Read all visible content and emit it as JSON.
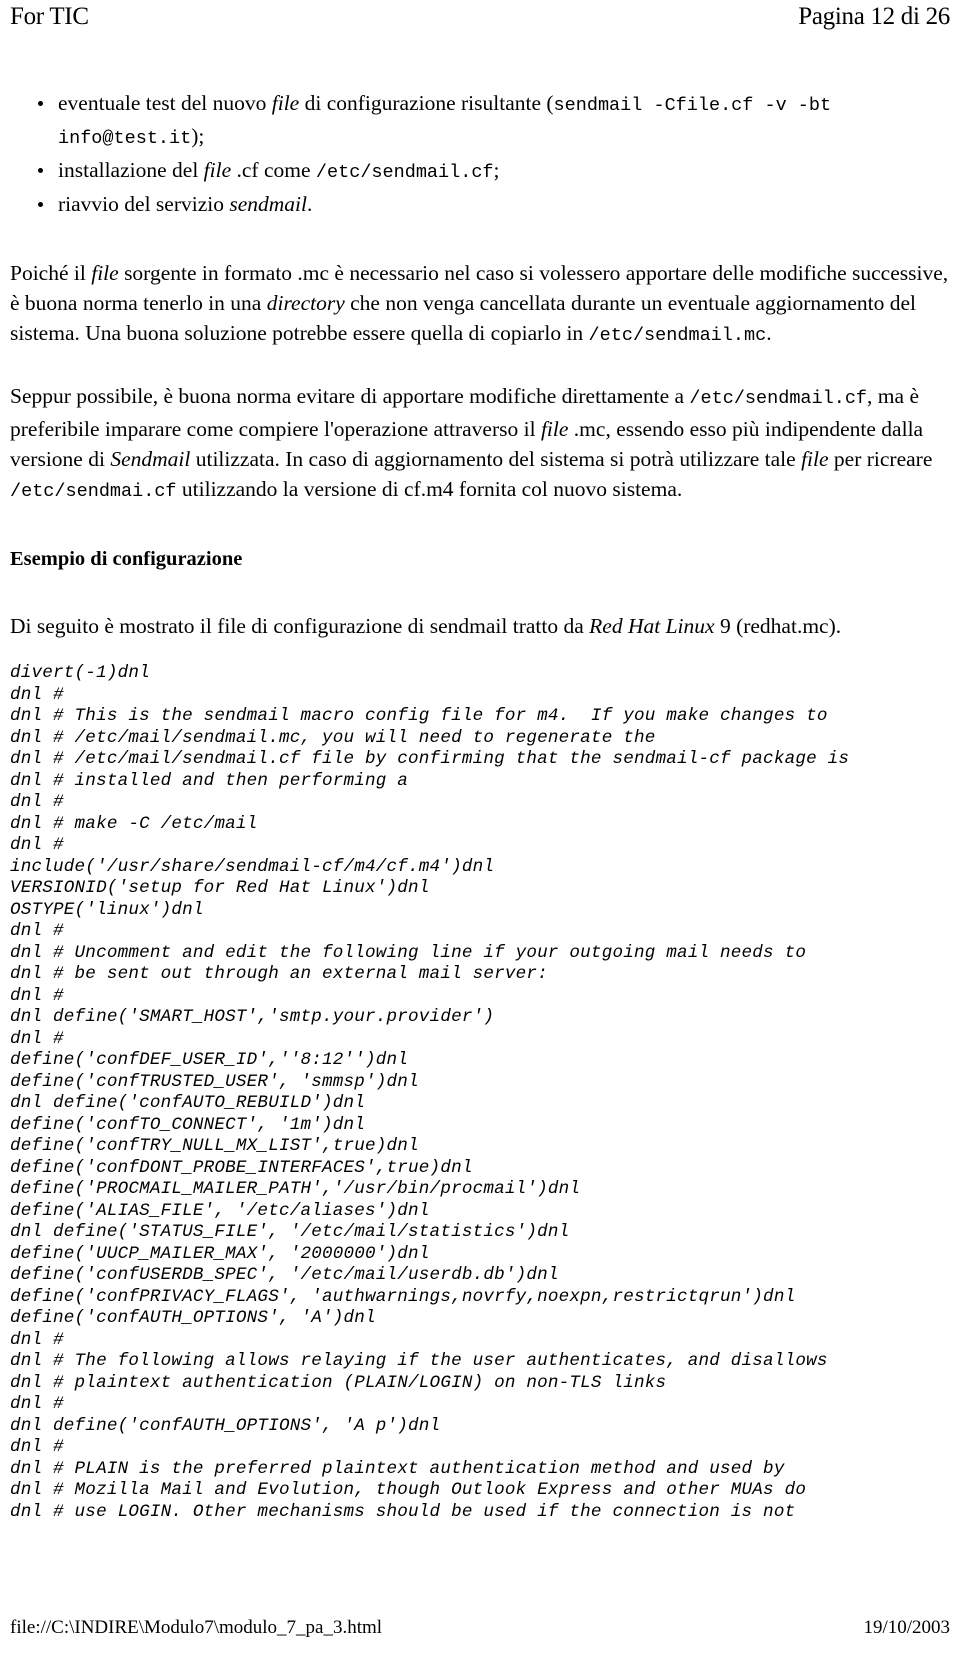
{
  "header": {
    "left": "For TIC",
    "right": "Pagina 12 di 26"
  },
  "bullets": [
    {
      "pre": "eventuale test del nuovo ",
      "italic": "file",
      "mid": " di configurazione risultante (",
      "code": "sendmail -Cfile.cf -v -bt info@test.it",
      "post": ");"
    },
    {
      "pre": "installazione del ",
      "italic": "file",
      "mid": " .cf come ",
      "code": "/etc/sendmail.cf",
      "post": ";"
    },
    {
      "pre": "riavvio del servizio ",
      "italic": "sendmail",
      "mid": "",
      "code": "",
      "post": "."
    }
  ],
  "paragraph1": {
    "t1": "Poiché il ",
    "i1": "file",
    "t2": " sorgente in formato .mc è necessario nel caso si volessero apportare delle modifiche successive, è buona norma tenerlo in una ",
    "i2": "directory",
    "t3": " che non venga cancellata durante un eventuale aggiornamento del sistema. Una buona soluzione potrebbe essere quella di copiarlo in ",
    "c1": "/etc/sendmail.mc",
    "t4": "."
  },
  "paragraph2": {
    "t1": "Seppur possibile, è buona norma evitare di apportare modifiche direttamente a ",
    "c1": "/etc/sendmail.cf",
    "t2": ", ma è preferibile imparare come compiere l'operazione attraverso il ",
    "i1": "file",
    "t3": " .mc, essendo esso più indipendente dalla versione di ",
    "i2": "Sendmail",
    "t4": " utilizzata. In caso di aggiornamento del sistema si potrà utilizzare tale ",
    "i3": "file",
    "t5": " per ricreare ",
    "c2": "/etc/sendmai.cf",
    "t6": " utilizzando la versione di cf.m4 fornita col nuovo sistema."
  },
  "section_heading": "Esempio di configurazione",
  "paragraph3": {
    "t1": "Di seguito è mostrato il file di configurazione di sendmail tratto da ",
    "i1": "Red Hat Linux",
    "t2": " 9 (redhat.mc)."
  },
  "code_listing": "divert(-1)dnl\ndnl #\ndnl # This is the sendmail macro config file for m4.  If you make changes to\ndnl # /etc/mail/sendmail.mc, you will need to regenerate the\ndnl # /etc/mail/sendmail.cf file by confirming that the sendmail-cf package is\ndnl # installed and then performing a\ndnl #\ndnl # make -C /etc/mail\ndnl #\ninclude('/usr/share/sendmail-cf/m4/cf.m4')dnl\nVERSIONID('setup for Red Hat Linux')dnl\nOSTYPE('linux')dnl\ndnl #\ndnl # Uncomment and edit the following line if your outgoing mail needs to\ndnl # be sent out through an external mail server:\ndnl #\ndnl define('SMART_HOST','smtp.your.provider')\ndnl #\ndefine('confDEF_USER_ID',''8:12'')dnl\ndefine('confTRUSTED_USER', 'smmsp')dnl\ndnl define('confAUTO_REBUILD')dnl\ndefine('confTO_CONNECT', '1m')dnl\ndefine('confTRY_NULL_MX_LIST',true)dnl\ndefine('confDONT_PROBE_INTERFACES',true)dnl\ndefine('PROCMAIL_MAILER_PATH','/usr/bin/procmail')dnl\ndefine('ALIAS_FILE', '/etc/aliases')dnl\ndnl define('STATUS_FILE', '/etc/mail/statistics')dnl\ndefine('UUCP_MAILER_MAX', '2000000')dnl\ndefine('confUSERDB_SPEC', '/etc/mail/userdb.db')dnl\ndefine('confPRIVACY_FLAGS', 'authwarnings,novrfy,noexpn,restrictqrun')dnl\ndefine('confAUTH_OPTIONS', 'A')dnl\ndnl #\ndnl # The following allows relaying if the user authenticates, and disallows\ndnl # plaintext authentication (PLAIN/LOGIN) on non-TLS links\ndnl #\ndnl define('confAUTH_OPTIONS', 'A p')dnl\ndnl #\ndnl # PLAIN is the preferred plaintext authentication method and used by\ndnl # Mozilla Mail and Evolution, though Outlook Express and other MUAs do\ndnl # use LOGIN. Other mechanisms should be used if the connection is not",
  "footer": {
    "left": "file://C:\\INDIRE\\Modulo7\\modulo_7_pa_3.html",
    "right": "19/10/2003"
  }
}
